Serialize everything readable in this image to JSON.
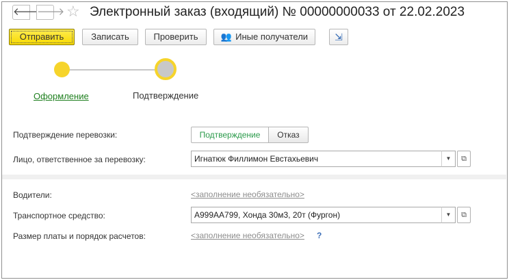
{
  "header": {
    "back_icon": "arrow-left-icon",
    "back_glyph": "🡐",
    "forward_icon": "arrow-right-icon",
    "forward_glyph": "🡒",
    "favorite_icon": "star-icon",
    "favorite_glyph": "☆",
    "title": "Электронный заказ (входящий) № 00000000033 от 22.02.2023"
  },
  "toolbar": {
    "send_label": "Отправить",
    "save_label": "Записать",
    "check_label": "Проверить",
    "recipients_label": "Иные получатели",
    "recipients_icon": "users-icon",
    "recipients_glyph": "👥",
    "export_icon": "export-icon",
    "export_glyph": "⇲"
  },
  "stepper": {
    "steps": [
      {
        "label": "Оформление",
        "state": "done"
      },
      {
        "label": "Подтверждение",
        "state": "current"
      }
    ],
    "accent_color": "#f6d42b"
  },
  "form": {
    "confirm_label": "Подтверждение перевозки:",
    "confirm_options": [
      "Подтверждение",
      "Отказ"
    ],
    "confirm_selected": "Подтверждение",
    "responsible_label": "Лицо, ответственное за перевозку:",
    "responsible_value": "Игнатюк Филлимон Евстахьевич",
    "drivers_label": "Водители:",
    "drivers_value": "<заполнение необязательно>",
    "vehicle_label": "Транспортное средство:",
    "vehicle_value": "А999АА799, Хонда  30м3, 20т (Фургон)",
    "payment_label": "Размер платы и порядок расчетов:",
    "payment_value": "<заполнение необязательно>",
    "help_glyph": "?",
    "dropdown_glyph": "▼",
    "open_glyph": "⧉"
  },
  "colors": {
    "primary_button": "#f7d900",
    "link_green": "#1e7f1e",
    "selected_green": "#2a9a4a"
  }
}
